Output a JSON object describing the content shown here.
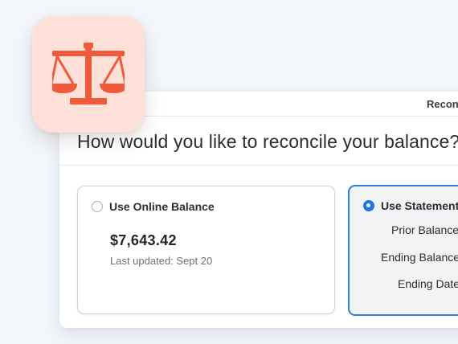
{
  "panel": {
    "topbar_title": "Reconcile",
    "question": "How would you like to reconcile your balance?"
  },
  "online_option": {
    "label": "Use Online Balance",
    "selected": false,
    "balance": "$7,643.42",
    "last_updated": "Last updated: Sept 20"
  },
  "statement_option": {
    "label": "Use Statement",
    "selected": true,
    "fields": {
      "prior_balance": "Prior Balance",
      "ending_balance": "Ending Balance",
      "ending_date": "Ending Date"
    }
  },
  "app_icon": {
    "icon": "scales-icon",
    "background": "#fde1d8",
    "color": "#f05a3c"
  },
  "colors": {
    "accent": "#1f76e0",
    "selected_border": "#2d7fd8"
  }
}
